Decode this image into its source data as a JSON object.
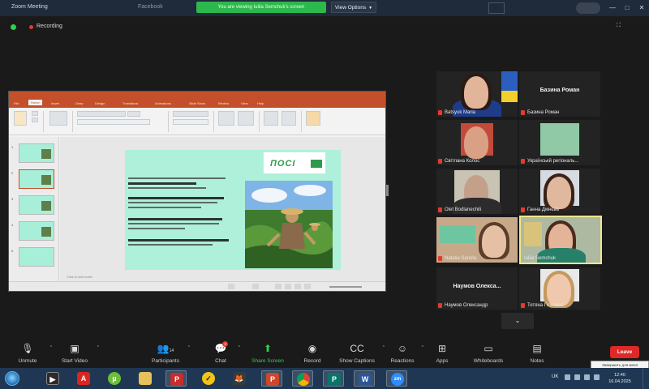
{
  "window": {
    "title": "Zoom Meeting",
    "second_tab": "Facebook",
    "share_banner": "You are viewing Iuliia Semchuk's screen",
    "view_options": "View Options",
    "minimize": "—",
    "maximize": "□",
    "close": "✕"
  },
  "meeting": {
    "recording_label": "Recording"
  },
  "presentation": {
    "tabs": [
      "File",
      "Home",
      "Insert",
      "Draw",
      "Design",
      "Transitions",
      "Animations",
      "Slide Show",
      "Review",
      "View",
      "Help"
    ],
    "slide_numbers": [
      "1",
      "2",
      "3",
      "4",
      "5"
    ],
    "logo_text": "ПОСІ",
    "notes_placeholder": "Click to add notes"
  },
  "participants": [
    {
      "name": "Batsyuk Maria",
      "muted": true
    },
    {
      "name": "Базина Роман",
      "big_name": "Базина Роман",
      "muted": true
    },
    {
      "name": "Світлана Колос",
      "muted": true
    },
    {
      "name": "Українськй регіональ...",
      "muted": true
    },
    {
      "name": "Olet Bodlanechili",
      "muted": true
    },
    {
      "name": "Ганна Дмнєва",
      "muted": true
    },
    {
      "name": "Natalia Sanola",
      "muted": true
    },
    {
      "name": "Iuliia Semchuk",
      "muted": false,
      "active_speaker": true
    },
    {
      "name": "Наумов Олександр",
      "big_name": "Наумов Олекса...",
      "muted": true
    },
    {
      "name": "Тетяна Гільмачі",
      "muted": true
    }
  ],
  "gallery_more": "⌄",
  "toolbar": {
    "unmute": "Unmute",
    "start_video": "Start Video",
    "participants": "Participants",
    "participants_count": "14",
    "chat": "Chat",
    "chat_badge": "3",
    "share_screen": "Share Screen",
    "record": "Record",
    "show_captions": "Show Captions",
    "reactions": "Reactions",
    "apps": "Apps",
    "whiteboards": "Whiteboards",
    "notes": "Notes",
    "leave": "Leave",
    "tooltip": "Завершить для меня"
  },
  "taskbar": {
    "zoom_label": "zm",
    "lang": "UK",
    "time": "12:40",
    "date": "16.04.2025"
  },
  "colors": {
    "zoom_green": "#2bd34a",
    "mute_red": "#e23b2e",
    "ppt_orange": "#c3502a",
    "slide_mint": "#aef0da",
    "leave_red": "#e02828",
    "active_speaker": "#f0e68c"
  }
}
